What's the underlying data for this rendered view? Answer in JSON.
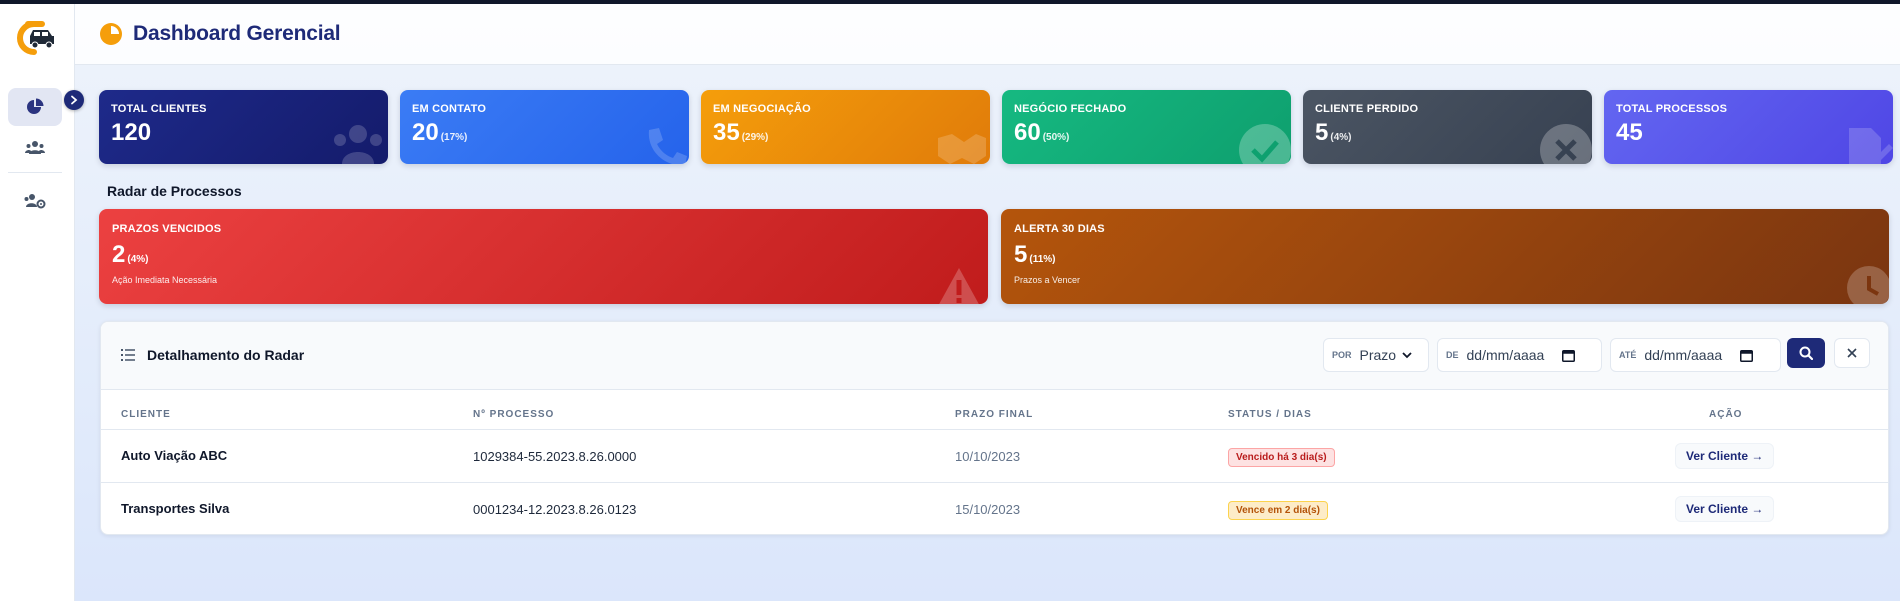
{
  "header": {
    "title": "Dashboard Gerencial"
  },
  "sidebar": {
    "items": [
      {
        "name": "dashboard",
        "icon": "pie-chart-icon",
        "active": true
      },
      {
        "name": "clientes",
        "icon": "users-icon"
      },
      {
        "name": "usuarios",
        "icon": "users-cog-icon"
      }
    ]
  },
  "stats": [
    {
      "label": "TOTAL CLIENTES",
      "value": "120",
      "pct": "",
      "icon": "users-icon",
      "color": "#1e2a8a"
    },
    {
      "label": "EM CONTATO",
      "value": "20",
      "pct": "(17%)",
      "icon": "phone-icon",
      "color": "#2f6ff0"
    },
    {
      "label": "EM NEGOCIAÇÃO",
      "value": "35",
      "pct": "(29%)",
      "icon": "handshake-icon",
      "color": "#ef8b0c"
    },
    {
      "label": "NEGÓCIO FECHADO",
      "value": "60",
      "pct": "(50%)",
      "icon": "check-circle-icon",
      "color": "#12a877"
    },
    {
      "label": "CLIENTE PERDIDO",
      "value": "5",
      "pct": "(4%)",
      "icon": "x-circle-icon",
      "color": "#3b4352"
    },
    {
      "label": "TOTAL PROCESSOS",
      "value": "45",
      "pct": "",
      "icon": "file-edit-icon",
      "color": "#5b50ec"
    }
  ],
  "radar": {
    "title": "Radar de Processos",
    "expired": {
      "label": "PRAZOS VENCIDOS",
      "value": "2",
      "pct": "(4%)",
      "sub": "Ação Imediata Necessária",
      "icon": "warning-icon",
      "color": "#dc2f2f"
    },
    "alert30": {
      "label": "ALERTA 30 DIAS",
      "value": "5",
      "pct": "(11%)",
      "sub": "Prazos a Vencer",
      "icon": "clock-icon",
      "color": "#a84d0a"
    }
  },
  "detail": {
    "title": "Detalhamento do Radar",
    "filters": {
      "por_label": "POR",
      "por_value": "Prazo",
      "de_label": "DE",
      "de_placeholder": "dd/mm/aaaa",
      "ate_label": "ATÉ",
      "ate_placeholder": "dd/mm/aaaa"
    },
    "columns": [
      "CLIENTE",
      "Nº PROCESSO",
      "PRAZO FINAL",
      "STATUS / DIAS",
      "AÇÃO"
    ],
    "rows": [
      {
        "cliente": "Auto Viação ABC",
        "processo": "1029384-55.2023.8.26.0000",
        "prazo": "10/10/2023",
        "status": "Vencido há 3 dia(s)",
        "status_type": "red",
        "acao": "Ver Cliente →"
      },
      {
        "cliente": "Transportes Silva",
        "processo": "0001234-12.2023.8.26.0123",
        "prazo": "15/10/2023",
        "status": "Vence em 2 dia(s)",
        "status_type": "amber",
        "acao": "Ver Cliente →"
      }
    ]
  }
}
